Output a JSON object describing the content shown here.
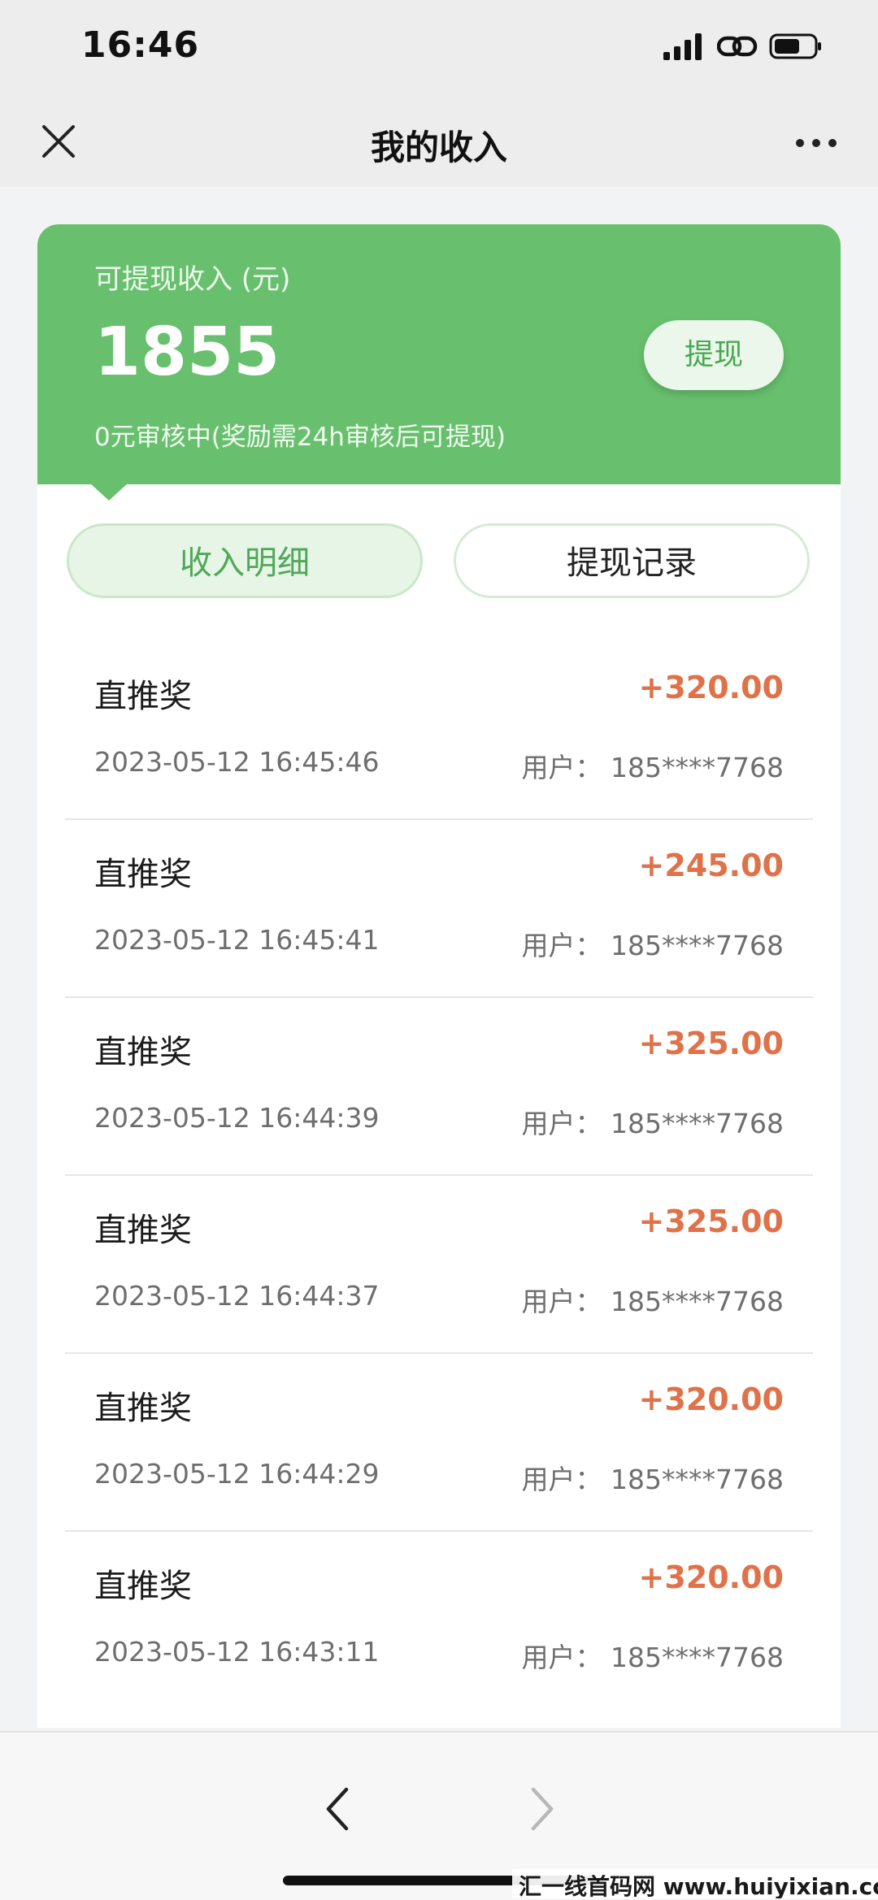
{
  "status_bar": {
    "time": "16:46"
  },
  "nav": {
    "title": "我的收入"
  },
  "income": {
    "label": "可提现收入 (元)",
    "amount": "1855",
    "note": "0元审核中(奖励需24h审核后可提现)",
    "withdraw_label": "提现"
  },
  "tabs": {
    "income_detail": "收入明细",
    "withdraw_record": "提现记录"
  },
  "records": [
    {
      "title": "直推奖",
      "amount": "+320.00",
      "time": "2023-05-12 16:45:46",
      "user": "用户：  185****7768"
    },
    {
      "title": "直推奖",
      "amount": "+245.00",
      "time": "2023-05-12 16:45:41",
      "user": "用户：  185****7768"
    },
    {
      "title": "直推奖",
      "amount": "+325.00",
      "time": "2023-05-12 16:44:39",
      "user": "用户：  185****7768"
    },
    {
      "title": "直推奖",
      "amount": "+325.00",
      "time": "2023-05-12 16:44:37",
      "user": "用户：  185****7768"
    },
    {
      "title": "直推奖",
      "amount": "+320.00",
      "time": "2023-05-12 16:44:29",
      "user": "用户：  185****7768"
    },
    {
      "title": "直推奖",
      "amount": "+320.00",
      "time": "2023-05-12 16:43:11",
      "user": "用户：  185****7768"
    }
  ],
  "colors": {
    "accent_green": "#68c06e",
    "amount_orange": "#e0724a"
  },
  "icons": {
    "close": "close-icon",
    "more": "more-icon",
    "back": "chevron-left-icon",
    "forward": "chevron-right-icon"
  },
  "watermark": "汇一线首码网 www.huiyixian.com"
}
